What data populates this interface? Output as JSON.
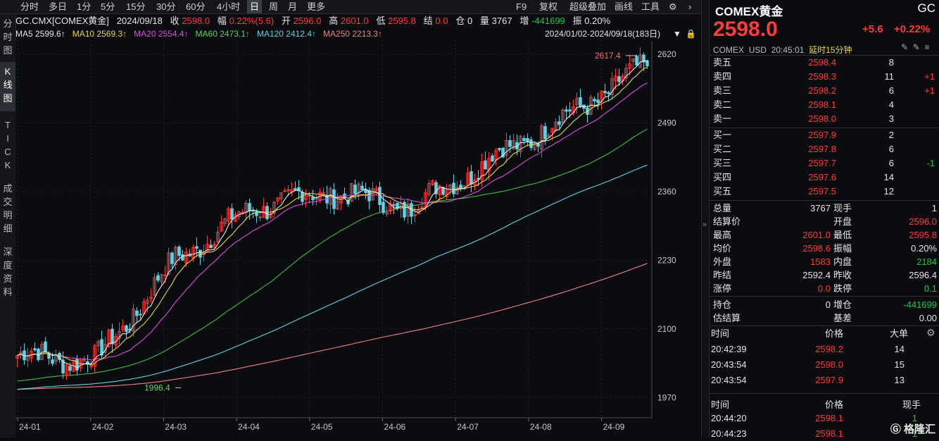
{
  "toolbar": {
    "periods": [
      "分时",
      "多日",
      "1分",
      "5分",
      "15分",
      "30分",
      "60分",
      "4小时",
      "日",
      "周",
      "月",
      "更多"
    ],
    "active_period": "日",
    "tools": [
      "F9",
      "复权",
      "超级叠加",
      "画线",
      "工具"
    ]
  },
  "leftnav": [
    {
      "chars": [
        "分",
        "时",
        "图"
      ]
    },
    {
      "chars": [
        "K",
        "线",
        "图"
      ]
    },
    {
      "chars": [
        "T",
        "I",
        "C",
        "K"
      ]
    },
    {
      "chars": [
        "成",
        "交",
        "明",
        "细"
      ]
    },
    {
      "chars": [
        "深",
        "度",
        "资",
        "料"
      ]
    }
  ],
  "info": {
    "symbol": "GC.CMX[COMEX黄金]",
    "date": "2024/09/18",
    "close_label": "收",
    "close": "2598.0",
    "change_label": "幅",
    "change": "0.22%(5.6)",
    "open_label": "开",
    "open": "2596.0",
    "high_label": "高",
    "high": "2601.0",
    "low_label": "低",
    "low": "2595.8",
    "settle_label": "结",
    "settle": "0.0",
    "oi_label": "仓",
    "oi": "0",
    "vol_label": "量",
    "vol": "3767",
    "inc_label": "增",
    "inc": "-441699",
    "amp_label": "振",
    "amp": "0.20%"
  },
  "ma": {
    "ma5": "MA5 2599.6↑",
    "ma10": "MA10 2569.3↑",
    "ma20": "MA20 2554.4↑",
    "ma60": "MA60 2473.1↑",
    "ma120": "MA120 2412.4↑",
    "ma250": "MA250 2213.3↑",
    "range": "2024/01/02-2024/09/18(183日)"
  },
  "chart_data": {
    "type": "candlestick",
    "y_ticks": [
      "2620",
      "2490",
      "2360",
      "2230",
      "2100",
      "1970"
    ],
    "x_ticks": [
      "24-01",
      "24-02",
      "24-03",
      "24-04",
      "24-05",
      "24-06",
      "24-07",
      "24-08",
      "24-09"
    ],
    "ylim": [
      1945,
      2640
    ],
    "annotations": {
      "high_label": "2617.4",
      "low_label": "1996.4"
    },
    "monthly_closes": [
      2050,
      2040,
      2230,
      2330,
      2360,
      2330,
      2420,
      2505,
      2600
    ],
    "ma_colors": {
      "ma5": "#e8e8e8",
      "ma10": "#e8d64a",
      "ma20": "#e04ce0",
      "ma60": "#3fbf3f",
      "ma120": "#5fd3e6",
      "ma250": "#f08080"
    }
  },
  "quote": {
    "name": "COMEX黄金",
    "code": "GC",
    "price": "2598.0",
    "chg": "+5.6",
    "chg_pct": "+0.22%",
    "exchange": "COMEX",
    "currency": "USD",
    "time": "20:45:01",
    "delay": "延时15分钟"
  },
  "book": {
    "asks": [
      {
        "label": "卖五",
        "price": "2598.4",
        "qty": "8",
        "chg": ""
      },
      {
        "label": "卖四",
        "price": "2598.3",
        "qty": "11",
        "chg": "+1"
      },
      {
        "label": "卖三",
        "price": "2598.2",
        "qty": "6",
        "chg": "+1"
      },
      {
        "label": "卖二",
        "price": "2598.1",
        "qty": "4",
        "chg": ""
      },
      {
        "label": "卖一",
        "price": "2598.0",
        "qty": "3",
        "chg": ""
      }
    ],
    "bids": [
      {
        "label": "买一",
        "price": "2597.9",
        "qty": "2",
        "chg": ""
      },
      {
        "label": "买二",
        "price": "2597.8",
        "qty": "6",
        "chg": ""
      },
      {
        "label": "买三",
        "price": "2597.7",
        "qty": "6",
        "chg": "-1"
      },
      {
        "label": "买四",
        "price": "2597.6",
        "qty": "14",
        "chg": ""
      },
      {
        "label": "买五",
        "price": "2597.5",
        "qty": "12",
        "chg": ""
      }
    ]
  },
  "stats": [
    {
      "l1": "总量",
      "v1": "3767",
      "c1": "white",
      "l2": "现手",
      "v2": "1",
      "c2": "white"
    },
    {
      "l1": "结算价",
      "v1": "",
      "c1": "white",
      "l2": "开盘",
      "v2": "2596.0",
      "c2": "red"
    },
    {
      "l1": "最高",
      "v1": "2601.0",
      "c1": "red",
      "l2": "最低",
      "v2": "2595.8",
      "c2": "red"
    },
    {
      "l1": "均价",
      "v1": "2598.6",
      "c1": "red",
      "l2": "振幅",
      "v2": "0.20%",
      "c2": "white"
    },
    {
      "l1": "外盘",
      "v1": "1583",
      "c1": "red",
      "l2": "内盘",
      "v2": "2184",
      "c2": "green"
    },
    {
      "l1": "昨结",
      "v1": "2592.4",
      "c1": "white",
      "l2": "昨收",
      "v2": "2596.4",
      "c2": "white"
    },
    {
      "l1": "涨停",
      "v1": "0.0",
      "c1": "red",
      "l2": "跌停",
      "v2": "0.1",
      "c2": "green"
    },
    {
      "l1": "持仓",
      "v1": "0",
      "c1": "white",
      "l2": "增仓",
      "v2": "-441699",
      "c2": "green"
    },
    {
      "l1": "估结算",
      "v1": "",
      "c1": "white",
      "l2": "基差",
      "v2": "0.00",
      "c2": "white"
    }
  ],
  "trades1": {
    "headers": [
      "时间",
      "价格",
      "大单"
    ],
    "rows": [
      {
        "time": "20:42:39",
        "price": "2598.2",
        "qty": "14"
      },
      {
        "time": "20:43:54",
        "price": "2598.0",
        "qty": "15"
      },
      {
        "time": "20:43:54",
        "price": "2597.9",
        "qty": "13"
      }
    ]
  },
  "trades2": {
    "headers": [
      "时间",
      "价格",
      "现手"
    ],
    "rows": [
      {
        "time": "20:44:20",
        "price": "2598.1",
        "qty": "1"
      },
      {
        "time": "20:44:23",
        "price": "2598.1",
        "qty": "1"
      }
    ]
  },
  "watermark": "格隆汇"
}
